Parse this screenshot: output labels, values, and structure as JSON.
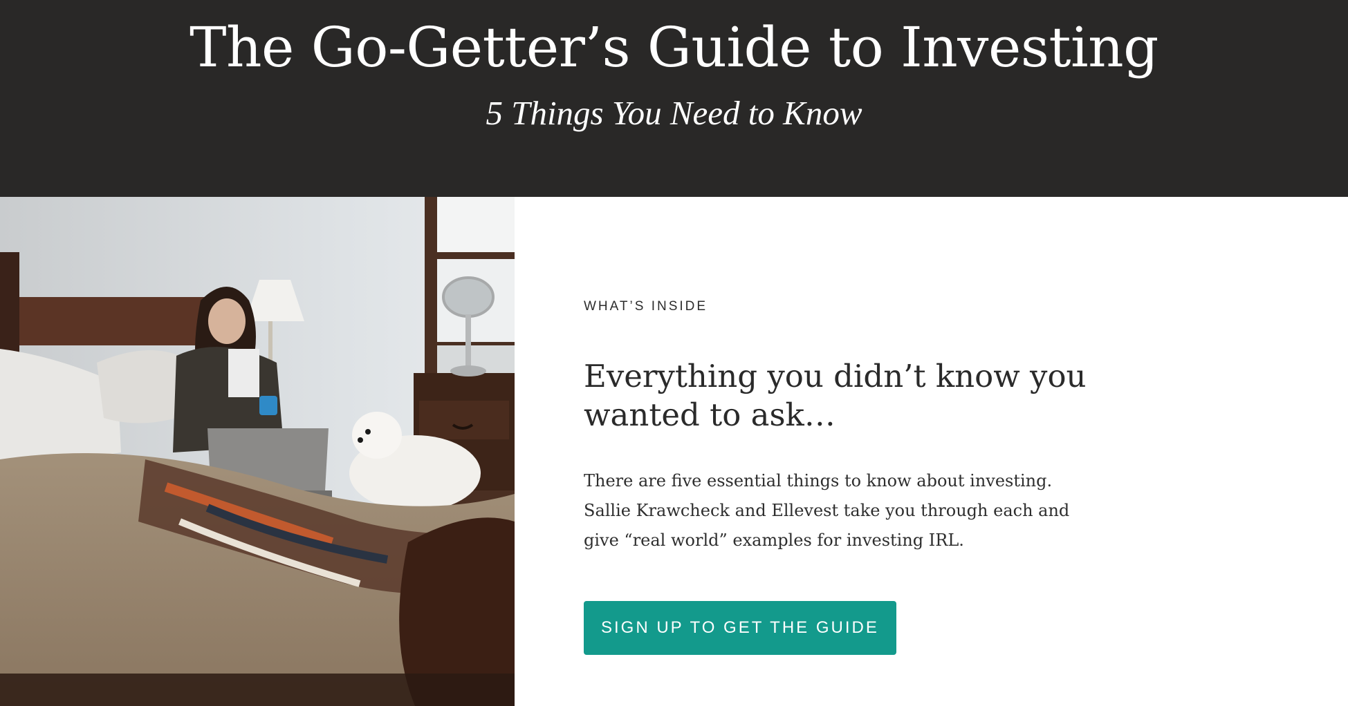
{
  "hero": {
    "title": "The Go-Getter’s Guide to Investing",
    "subtitle": "5 Things You Need to Know"
  },
  "photo": {
    "subject": "woman-on-bed-with-laptop-and-dog"
  },
  "content": {
    "eyebrow": "WHAT’S INSIDE",
    "headline": "Everything you didn’t know you wanted to ask…",
    "body": "There are five essential things to know about investing. Sallie Krawcheck and Ellevest take you through each and give “real world” examples for investing IRL.",
    "cta_label": "SIGN UP TO GET THE GUIDE"
  },
  "colors": {
    "hero_bg": "#292827",
    "cta_bg": "#139a8c",
    "text_dark": "#2a2a2a"
  }
}
